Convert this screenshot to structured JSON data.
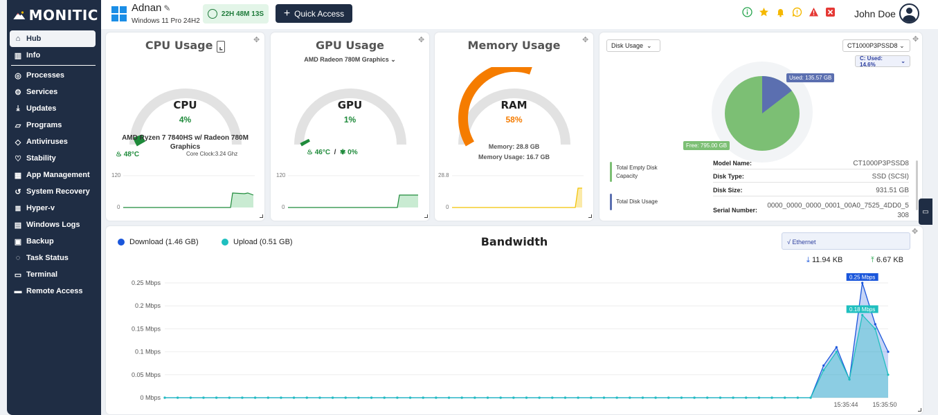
{
  "app": {
    "brand": "MONITIC"
  },
  "sidebar": {
    "items": [
      {
        "label": "Hub",
        "icon": "home-icon",
        "active": true
      },
      {
        "label": "Info",
        "icon": "info-chart-icon"
      },
      {
        "label": "Processes",
        "icon": "processes-icon"
      },
      {
        "label": "Services",
        "icon": "services-gear-icon"
      },
      {
        "label": "Updates",
        "icon": "download-icon"
      },
      {
        "label": "Programs",
        "icon": "folder-icon"
      },
      {
        "label": "Antiviruses",
        "icon": "shield-icon"
      },
      {
        "label": "Stability",
        "icon": "heart-icon"
      },
      {
        "label": "App Management",
        "icon": "grid-icon"
      },
      {
        "label": "System Recovery",
        "icon": "history-icon"
      },
      {
        "label": "Hyper-v",
        "icon": "database-icon"
      },
      {
        "label": "Windows Logs",
        "icon": "logs-grid-icon"
      },
      {
        "label": "Backup",
        "icon": "backup-icon"
      },
      {
        "label": "Task Status",
        "icon": "task-status-icon"
      },
      {
        "label": "Terminal",
        "icon": "terminal-icon"
      },
      {
        "label": "Remote Access",
        "icon": "monitor-icon"
      }
    ]
  },
  "header": {
    "hostname": "Adnan",
    "os": "Windows 11 Pro 24H2",
    "uptime": "22H 48M 13S",
    "quick_access": "Quick Access",
    "user": "John Doe",
    "icons": [
      "info-icon",
      "star-icon",
      "bell-icon",
      "message-alert-icon",
      "warning-icon",
      "close-square-icon"
    ],
    "colors": {
      "info": "#22a34a",
      "star": "#f5b800",
      "bell": "#f5b800",
      "message": "#f5b800",
      "warning": "#e53935",
      "close": "#e53935"
    }
  },
  "cpu": {
    "title": "CPU Usage",
    "label": "CPU",
    "percent": "4%",
    "percent_value": 4,
    "model": "AMD Ryzen 7 7840HS w/ Radeon 780M Graphics",
    "temp": "48°C",
    "clock": "Core Clock:3.24 Ghz",
    "axis_max": "120",
    "axis_min": "0",
    "color": "#1e8a3a"
  },
  "gpu": {
    "title": "GPU Usage",
    "model": "AMD Radeon 780M Graphics",
    "label": "GPU",
    "percent": "1%",
    "percent_value": 1,
    "temp": "46°C",
    "sep": "/",
    "fan": "0%",
    "axis_max": "120",
    "axis_min": "0",
    "color": "#1e8a3a"
  },
  "memory": {
    "title": "Memory Usage",
    "label": "RAM",
    "percent": "58%",
    "percent_value": 58,
    "total": "Memory: 28.8 GB",
    "used": "Memory Usage: 16.7 GB",
    "axis_max": "28.8",
    "axis_min": "0",
    "color": "#f57c00"
  },
  "disk": {
    "view_select": "Disk Usage",
    "drive_select": "CT1000P3PSSD8",
    "partition_select": "C: Used: 14.6%",
    "used_tag": "Used: 135.57 GB",
    "free_tag": "Free: 795.00 GB",
    "used_value": 135.57,
    "free_value": 795.0,
    "legend": [
      {
        "label": "Total Empty Disk Capacity",
        "color": "#7cbf74"
      },
      {
        "label": "Total Disk Usage",
        "color": "#5b6fb0"
      }
    ],
    "rows": [
      {
        "k": "Model Name:",
        "v": "CT1000P3PSSD8"
      },
      {
        "k": "Disk Type:",
        "v": "SSD (SCSI)"
      },
      {
        "k": "Disk Size:",
        "v": "931.51 GB"
      },
      {
        "k": "Serial Number:",
        "v": "0000_0000_0000_0001_00A0_7525_4DD0_5308"
      }
    ]
  },
  "bandwidth": {
    "title": "Bandwidth",
    "download_label": "Download (1.46 GB)",
    "upload_label": "Upload (0.51 GB)",
    "interface": "√ Ethernet",
    "down_rate": "11.94 KB",
    "up_rate": "6.67 KB",
    "down_tag": "0.25 Mbps",
    "up_tag": "0.18 Mbps",
    "colors": {
      "download": "#1a56db",
      "upload": "#1fbfbf"
    }
  },
  "chart_data": {
    "type": "line",
    "title": "Bandwidth",
    "ylim": [
      0,
      0.25
    ],
    "yticks": [
      "0 Mbps",
      "0.05 Mbps",
      "0.1 Mbps",
      "0.15 Mbps",
      "0.2 Mbps",
      "0.25 Mbps"
    ],
    "xticks": [
      "15:35:44",
      "15:35:50"
    ],
    "series": [
      {
        "name": "Download (1.46 GB)",
        "values": [
          0,
          0,
          0,
          0,
          0,
          0,
          0,
          0,
          0,
          0,
          0,
          0,
          0,
          0,
          0,
          0,
          0,
          0,
          0,
          0,
          0,
          0,
          0,
          0,
          0,
          0,
          0,
          0,
          0,
          0,
          0,
          0,
          0,
          0,
          0,
          0,
          0,
          0,
          0,
          0,
          0,
          0,
          0,
          0,
          0,
          0,
          0,
          0,
          0,
          0,
          0,
          0.07,
          0.11,
          0.04,
          0.25,
          0.16,
          0.1
        ]
      },
      {
        "name": "Upload (0.51 GB)",
        "values": [
          0,
          0,
          0,
          0,
          0,
          0,
          0,
          0,
          0,
          0,
          0,
          0,
          0,
          0,
          0,
          0,
          0,
          0,
          0,
          0,
          0,
          0,
          0,
          0,
          0,
          0,
          0,
          0,
          0,
          0,
          0,
          0,
          0,
          0,
          0,
          0,
          0,
          0,
          0,
          0,
          0,
          0,
          0,
          0,
          0,
          0,
          0,
          0,
          0,
          0,
          0,
          0.06,
          0.1,
          0.04,
          0.18,
          0.15,
          0.05
        ]
      }
    ]
  }
}
